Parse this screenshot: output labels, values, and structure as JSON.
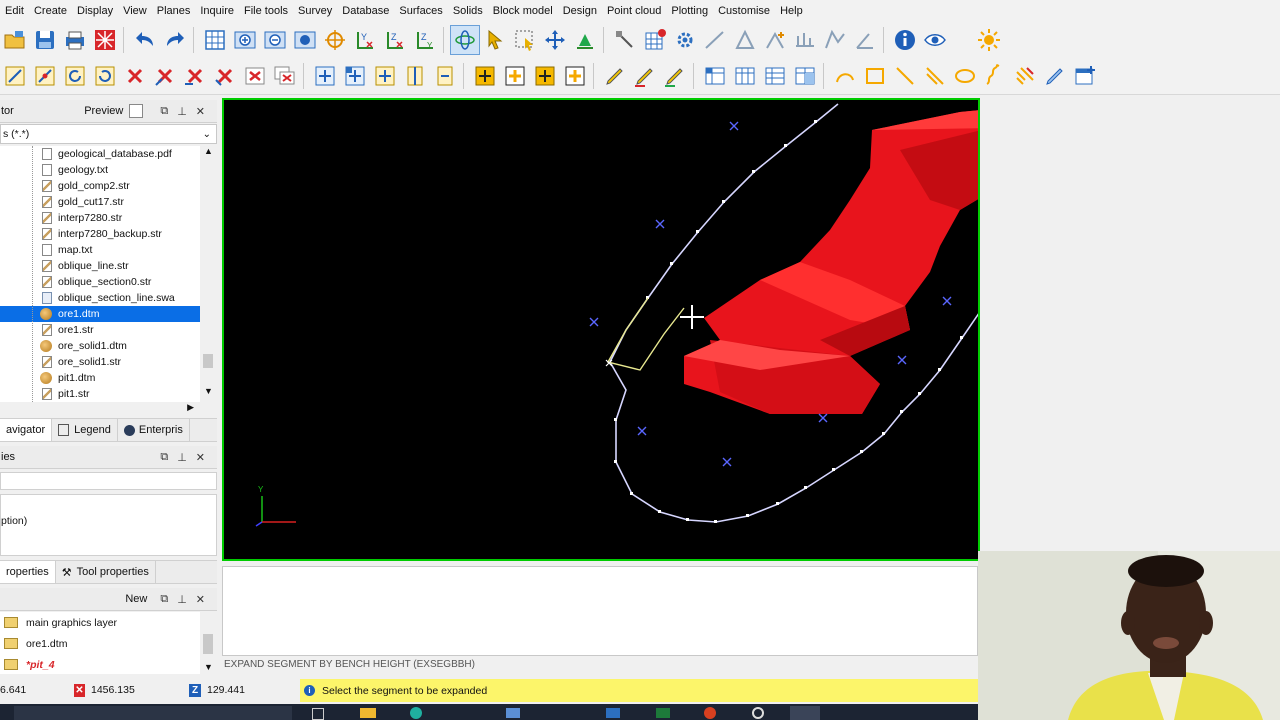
{
  "menu": [
    "Edit",
    "Create",
    "Display",
    "View",
    "Planes",
    "Inquire",
    "File tools",
    "Survey",
    "Database",
    "Surfaces",
    "Solids",
    "Block model",
    "Design",
    "Point cloud",
    "Plotting",
    "Customise",
    "Help"
  ],
  "toolbar1_icons": [
    "folder-open-icon",
    "save-icon",
    "print-icon",
    "grid-red-icon",
    "undo-icon",
    "redo-icon",
    "grid-view-icon",
    "zoom-in-icon",
    "zoom-out-icon",
    "zoom-fit-icon",
    "target-icon",
    "plane-yx-icon",
    "plane-zx-icon",
    "plane-zy-icon",
    "rotate-3d-icon",
    "select-arrow-icon",
    "select-box-icon",
    "move-icon",
    "arrow-up-icon",
    "measure-icon",
    "grid-red-cross-icon",
    "gear-icon",
    "draw-line-icon",
    "triangle-icon",
    "point-plus-icon",
    "profile-icon",
    "section-icon",
    "angle-icon",
    "info-icon",
    "eye-icon",
    "sun-icon"
  ],
  "toolbar2_icons": [
    "edit-segment-icon",
    "edit-point-icon",
    "rotate-icon",
    "refresh-icon",
    "delete-x-icon",
    "delete-point-icon",
    "delete-segment-icon",
    "delete-string-icon",
    "delete-range-icon",
    "delete-layer-icon",
    "insert-point-icon",
    "insert-segment-icon",
    "add-point-icon",
    "split-icon",
    "merge-icon",
    "box-plus-icon",
    "box-plus2-icon",
    "box-plus3-icon",
    "box-plus4-icon",
    "pencil-icon",
    "pencil-red-icon",
    "pencil-green-icon",
    "table-icon",
    "table2-icon",
    "table3-icon",
    "table4-icon",
    "curve-icon",
    "loop-icon",
    "line-icon",
    "line2-icon",
    "ellipse-icon",
    "spring-icon",
    "hatch-icon",
    "pen-icon",
    "window-add-icon"
  ],
  "navigator": {
    "title": "tor",
    "preview_label": "Preview",
    "filter": "s (*.*)",
    "files": [
      {
        "name": "geological_database.pdf",
        "type": "txt"
      },
      {
        "name": "geology.txt",
        "type": "txt"
      },
      {
        "name": "gold_comp2.str",
        "type": "str"
      },
      {
        "name": "gold_cut17.str",
        "type": "str"
      },
      {
        "name": "interp7280.str",
        "type": "str"
      },
      {
        "name": "interp7280_backup.str",
        "type": "str"
      },
      {
        "name": "map.txt",
        "type": "txt"
      },
      {
        "name": "oblique_line.str",
        "type": "str"
      },
      {
        "name": "oblique_section0.str",
        "type": "str"
      },
      {
        "name": "oblique_section_line.swa",
        "type": "swa"
      },
      {
        "name": "ore1.dtm",
        "type": "dtm",
        "selected": true
      },
      {
        "name": "ore1.str",
        "type": "str"
      },
      {
        "name": "ore_solid1.dtm",
        "type": "dtm"
      },
      {
        "name": "ore_solid1.str",
        "type": "str"
      },
      {
        "name": "pit1.dtm",
        "type": "dtm"
      },
      {
        "name": "pit1.str",
        "type": "str"
      }
    ],
    "tabs": [
      "avigator",
      "Legend",
      "Enterpris"
    ]
  },
  "properties": {
    "title": "ies",
    "text": "ption)",
    "tabs": [
      "roperties",
      "Tool properties"
    ]
  },
  "layers": {
    "new_label": "New",
    "items": [
      {
        "name": "main graphics layer",
        "style": "normal"
      },
      {
        "name": "ore1.dtm",
        "style": "normal"
      },
      {
        "name": "*pit_4",
        "style": "active"
      }
    ]
  },
  "command_line": "EXPAND SEGMENT BY BENCH HEIGHT (EXSEGBBH)",
  "status": {
    "x": "6.641",
    "y": "1456.135",
    "z": "129.441",
    "message": "Select the segment to be expanded"
  },
  "colors": {
    "viewport_border": "#00cc00",
    "solid": "#e8141c",
    "outline": "#d6d6ff",
    "prompt_bg": "#fcf56a",
    "selection": "#0a6ee6"
  }
}
